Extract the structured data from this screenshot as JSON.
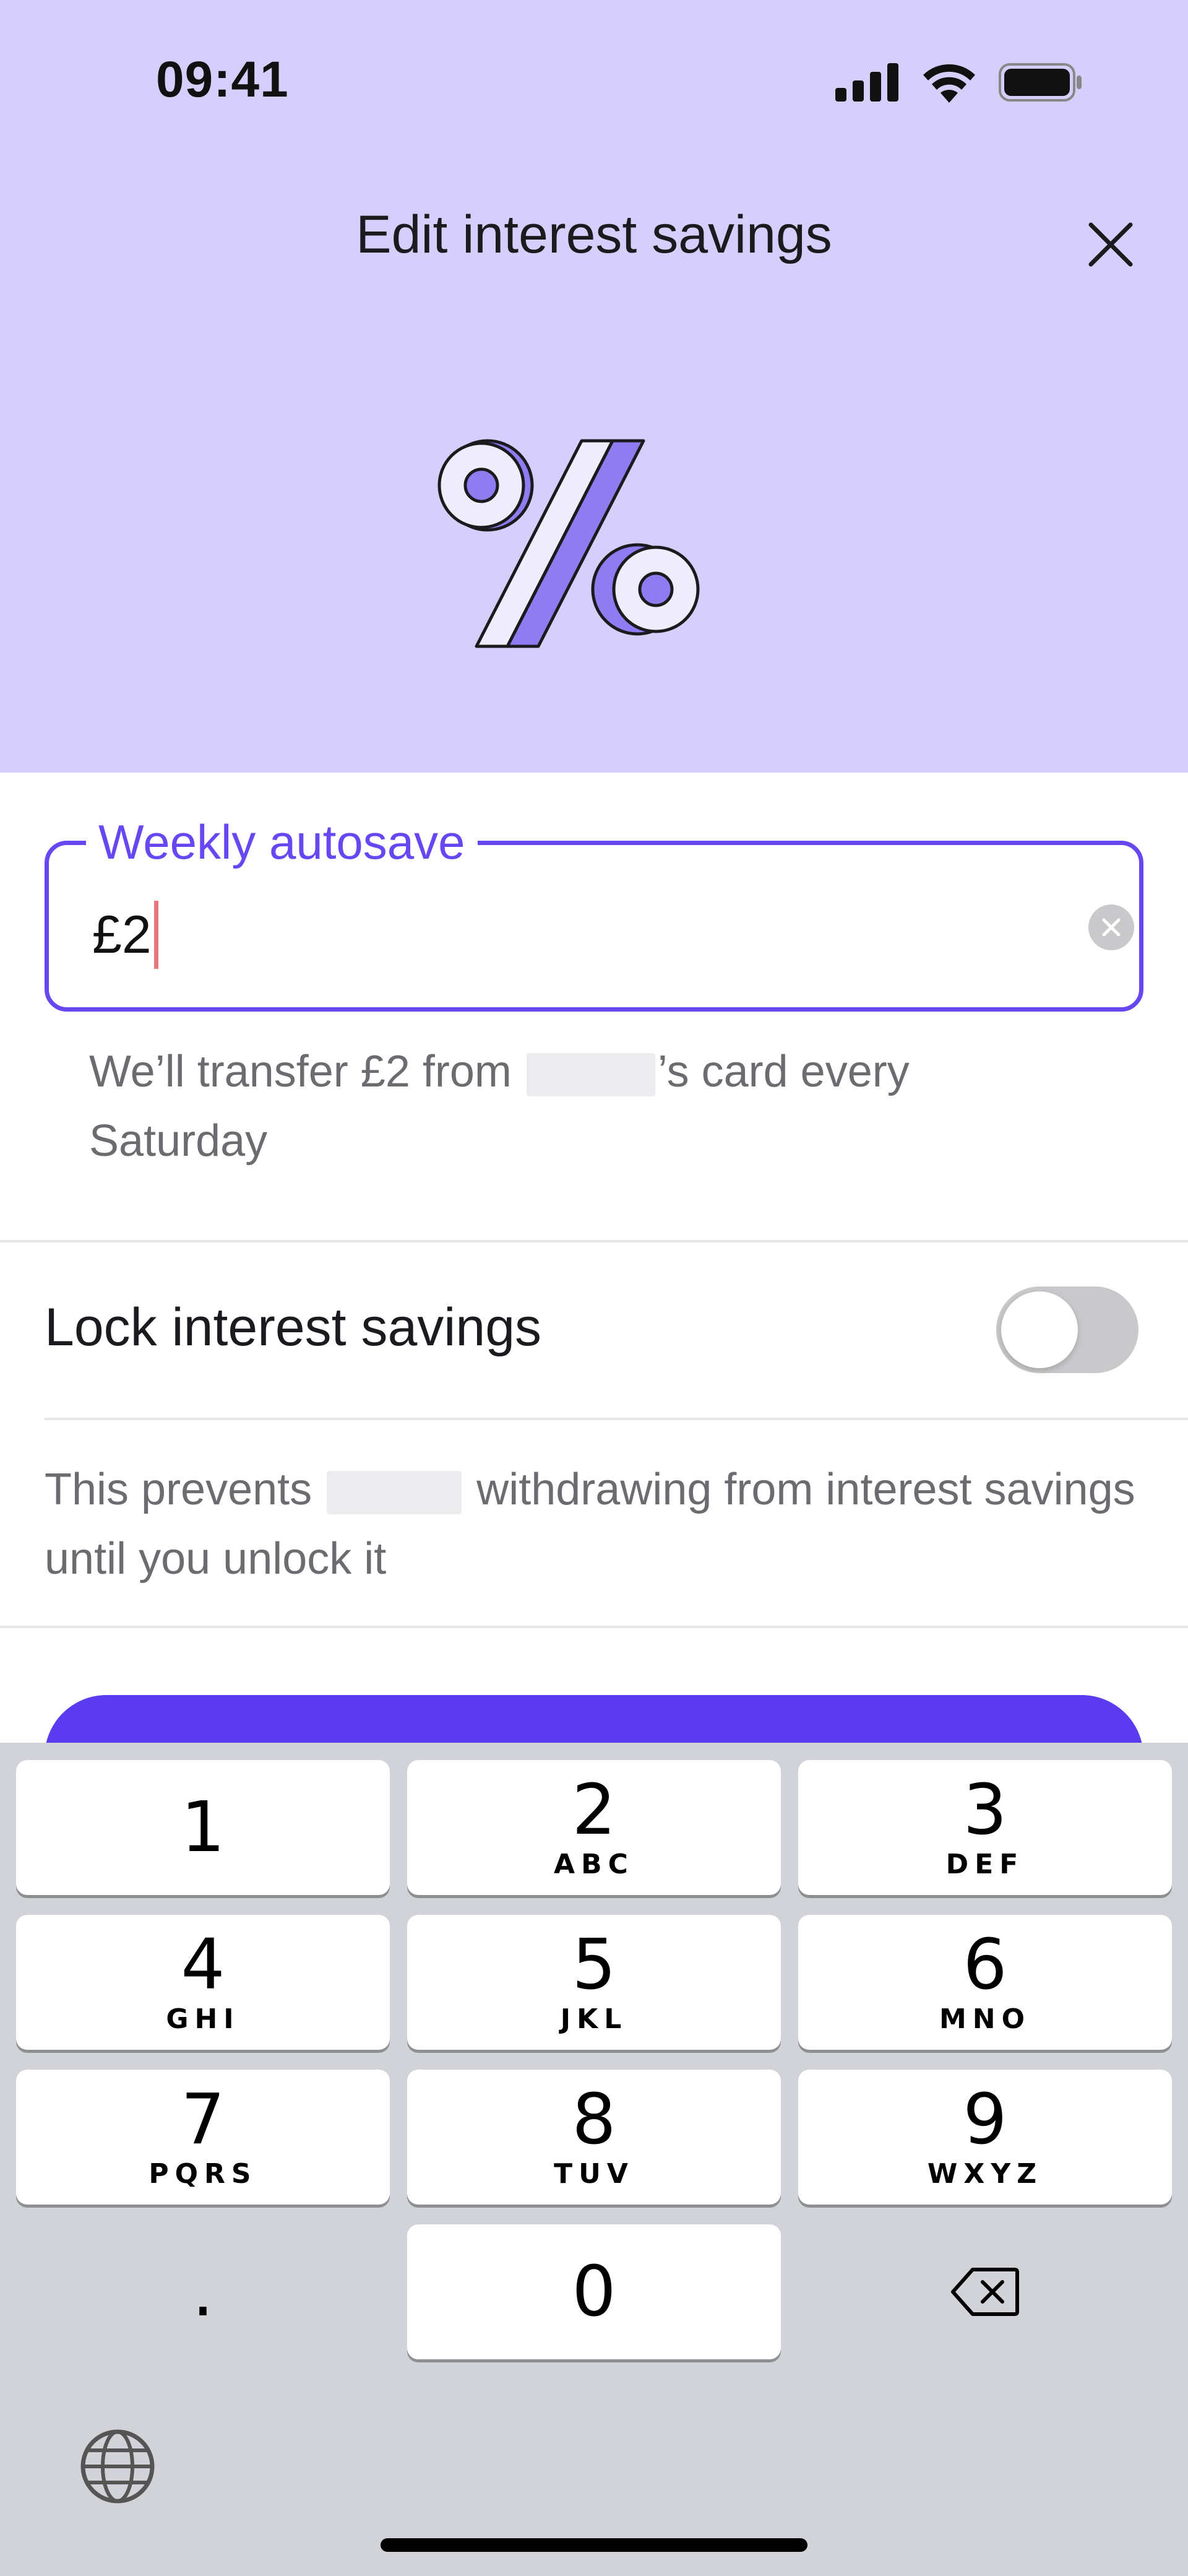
{
  "status_bar": {
    "time": "09:41",
    "icons": [
      "signal-icon",
      "wifi-icon",
      "battery-icon"
    ]
  },
  "header": {
    "title": "Edit interest savings",
    "close_icon": "close-icon",
    "illustration": "percent-icon",
    "background_color": "#d6cffc"
  },
  "autosave": {
    "label": "Weekly autosave",
    "value": "£2",
    "helper_prefix": "We’ll transfer £2 from",
    "helper_suffix": "’s card every Saturday"
  },
  "lock": {
    "label": "Lock interest savings",
    "enabled": false,
    "desc_prefix": "This prevents",
    "desc_suffix": "withdrawing from interest savings until you unlock it"
  },
  "colors": {
    "accent": "#6747f2",
    "primary_button": "#5b3bf0"
  },
  "keyboard": {
    "keys": [
      {
        "num": "1",
        "letters": ""
      },
      {
        "num": "2",
        "letters": "ABC"
      },
      {
        "num": "3",
        "letters": "DEF"
      },
      {
        "num": "4",
        "letters": "GHI"
      },
      {
        "num": "5",
        "letters": "JKL"
      },
      {
        "num": "6",
        "letters": "MNO"
      },
      {
        "num": "7",
        "letters": "PQRS"
      },
      {
        "num": "8",
        "letters": "TUV"
      },
      {
        "num": "9",
        "letters": "WXYZ"
      }
    ],
    "decimal": ".",
    "zero": "0",
    "delete_icon": "backspace-icon",
    "globe_icon": "globe-icon"
  }
}
